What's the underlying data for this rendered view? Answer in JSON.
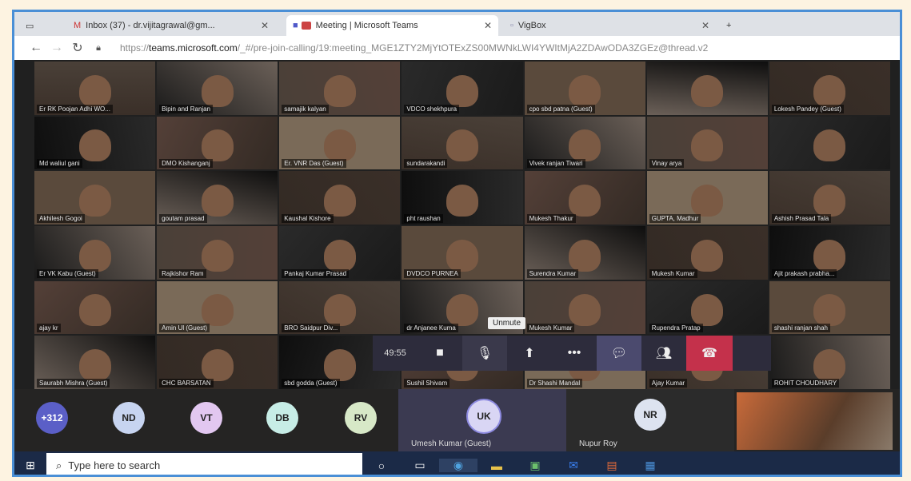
{
  "browser": {
    "tabs": [
      {
        "label": "Inbox (37) - dr.vijitagrawal@gm..."
      },
      {
        "label": "Meeting | Microsoft Teams"
      },
      {
        "label": "VigBox"
      }
    ],
    "url_prefix": "https://",
    "url_host": "teams.microsoft.com",
    "url_rest": "/_#/pre-join-calling/19:meeting_MGE1ZTY2MjYtOTExZS00MWNkLWI4YWItMjA2ZDAwODA3ZGEz@thread.v2"
  },
  "participants": [
    "Er RK Poojan Adhi WO...",
    "Bipin and Ranjan",
    "samajik kalyan",
    "VDCO shekhpura",
    "cpo sbd patna (Guest)",
    "",
    "Lokesh Pandey (Guest)",
    "Md waliul gani",
    "DMO Kishanganj",
    "Er. VNR Das (Guest)",
    "sundarakandi",
    "Vivek ranjan Tiwari",
    "Vinay arya",
    "",
    "Akhilesh Gogoi",
    "goutam prasad",
    "Kaushal Kishore",
    "pht raushan",
    "Mukesh Thakur",
    "GUPTA, Madhur",
    "Ashish Prasad Tala",
    "Er VK Kabu (Guest)",
    "Rajkishor Ram",
    "Pankaj Kumar Prasad",
    "DVDCO PURNEA",
    "Surendra Kumar",
    "Mukesh Kumar",
    "Ajit prakash prabha...",
    "ajay kr",
    "Amin Ul (Guest)",
    "BRO Saidpur Div...",
    "dr Anjanee Kuma",
    "Mukesh Kumar",
    "Rupendra Pratap",
    "shashi ranjan shah",
    "Saurabh Mishra (Guest)",
    "CHC BARSATAN",
    "sbd godda (Guest)",
    "Sushil Shivam",
    "Dr Shashi Mandal",
    "Ajay Kumar",
    "ROHIT CHOUDHARY"
  ],
  "call": {
    "timer": "49:55",
    "tooltip": "Unmute"
  },
  "strip": {
    "overflow_count": "+312",
    "avatars": [
      "ND",
      "VT",
      "DB",
      "RV"
    ],
    "featured": {
      "initials": "UK",
      "name": "Umesh Kumar (Guest)"
    },
    "second": {
      "initials": "NR",
      "name": "Nupur Roy"
    }
  },
  "taskbar": {
    "search_placeholder": "Type here to search"
  }
}
